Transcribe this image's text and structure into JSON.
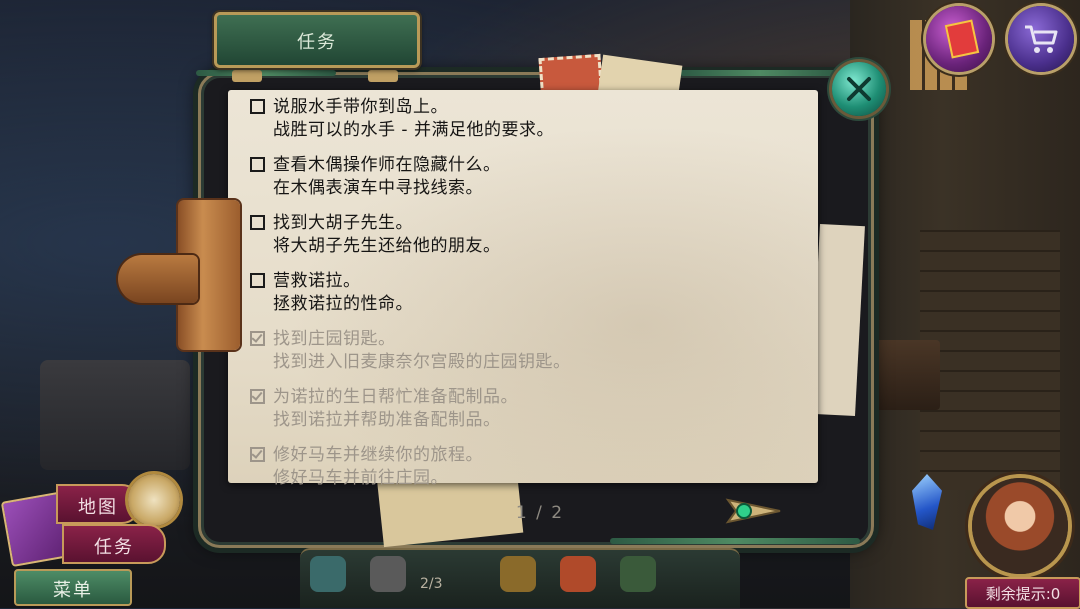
{
  "header": {
    "title": "任务"
  },
  "tasks": [
    {
      "line1": "说服水手带你到岛上。",
      "line2": "战胜可以的水手 - 并满足他的要求。",
      "done": false
    },
    {
      "line1": "查看木偶操作师在隐藏什么。",
      "line2": "在木偶表演车中寻找线索。",
      "done": false
    },
    {
      "line1": "找到大胡子先生。",
      "line2": "将大胡子先生还给他的朋友。",
      "done": false
    },
    {
      "line1": "营救诺拉。",
      "line2": "拯救诺拉的性命。",
      "done": false
    },
    {
      "line1": "找到庄园钥匙。",
      "line2": "找到进入旧麦康奈尔宫殿的庄园钥匙。",
      "done": true
    },
    {
      "line1": "为诺拉的生日帮忙准备配制品。",
      "line2": "找到诺拉并帮助准备配制品。",
      "done": true
    },
    {
      "line1": "修好马车并继续你的旅程。",
      "line2": "修好马车并前往庄园。",
      "done": true
    }
  ],
  "pagination": {
    "label": "1 / 2",
    "current": 1,
    "total": 2
  },
  "left_menu": {
    "map_label": "地图",
    "tasks_label": "任务",
    "menu_label": "菜单"
  },
  "hints": {
    "label": "剩余提示:0"
  },
  "inventory": {
    "count_label": "2/3"
  },
  "icons": {
    "close": "close-x-icon",
    "shop_gift": "gift-icon",
    "shop_cart": "shopping-cart-icon",
    "next_page": "arrow-right-icon"
  },
  "colors": {
    "paper": "#e8e0cf",
    "accent_green": "#2f6a4a",
    "accent_magenta": "#7a1b40",
    "done_text": "#9d958a"
  }
}
